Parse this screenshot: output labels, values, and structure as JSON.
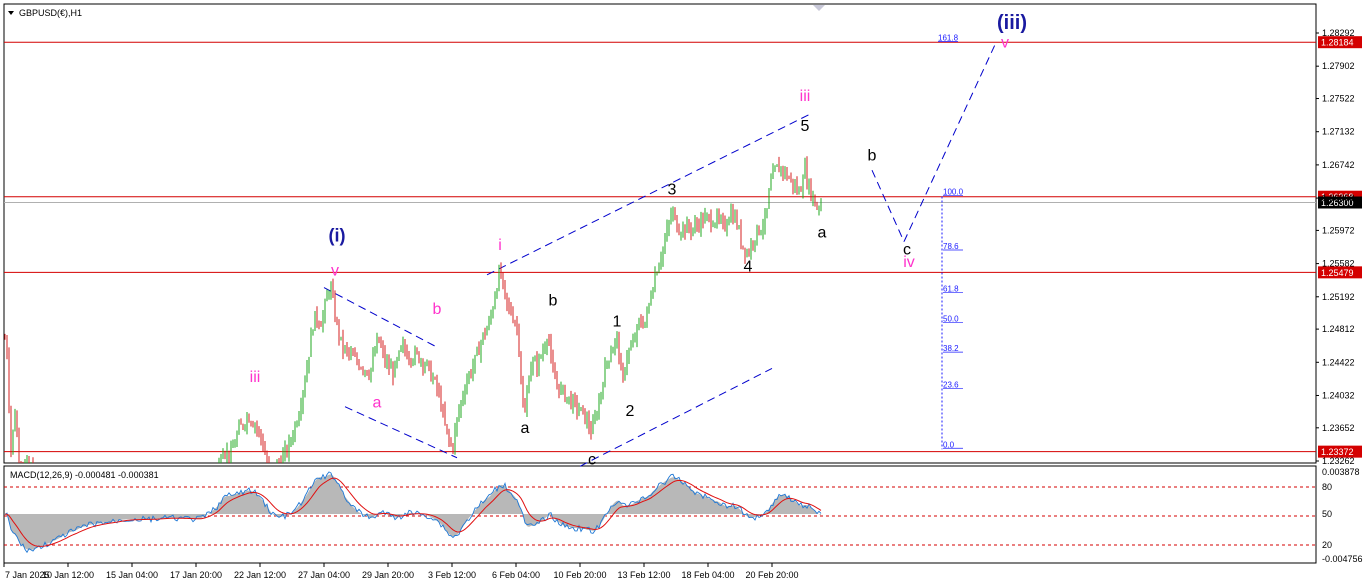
{
  "header": {
    "symbol_title": "GBPUSD(€),H1",
    "macd_title": "MACD(12,26,9) -0.000481 -0.000381"
  },
  "colors": {
    "up_candle": "#22aa22",
    "down_candle": "#d42020",
    "resistance_line": "#d40000",
    "trendline": "#0000cc",
    "fib_line": "#1a1aff",
    "macd_hist": "#b8b8b8",
    "macd_line": "#1e78d6",
    "signal_line": "#e01010",
    "wave_blue": "#1a1aa0",
    "wave_magenta": "#ff33cc",
    "wave_black": "#000000"
  },
  "chart_data": [
    {
      "type": "candlestick",
      "title": "GBPUSD(€),H1",
      "ylim": [
        1.23262,
        1.28292
      ],
      "y_ticks": [
        "1.28292",
        "1.27902",
        "1.27522",
        "1.27132",
        "1.26742",
        "1.26352",
        "1.25972",
        "1.25582",
        "1.25192",
        "1.24812",
        "1.24422",
        "1.24032",
        "1.23652",
        "1.23262"
      ],
      "x_ticks": [
        "7 Jan 2025",
        "10 Jan 12:00",
        "15 Jan 04:00",
        "17 Jan 20:00",
        "22 Jan 12:00",
        "27 Jan 04:00",
        "29 Jan 20:00",
        "3 Feb 12:00",
        "6 Feb 04:00",
        "10 Feb 20:00",
        "13 Feb 12:00",
        "18 Feb 04:00",
        "20 Feb 20:00"
      ],
      "price_anchors": [
        [
          0,
          1.2483
        ],
        [
          2,
          1.249
        ],
        [
          4,
          1.247
        ],
        [
          6,
          1.247
        ],
        [
          8,
          1.244
        ],
        [
          10,
          1.235
        ],
        [
          12,
          1.233
        ],
        [
          14,
          1.239
        ],
        [
          16,
          1.238
        ],
        [
          18,
          1.233
        ],
        [
          48,
          1.23
        ],
        [
          200,
          1.225
        ],
        [
          216,
          1.23
        ],
        [
          222,
          1.2345
        ],
        [
          230,
          1.233
        ],
        [
          238,
          1.236
        ],
        [
          248,
          1.238
        ],
        [
          255,
          1.237
        ],
        [
          262,
          1.235
        ],
        [
          270,
          1.231
        ],
        [
          288,
          1.234
        ],
        [
          298,
          1.238
        ],
        [
          306,
          1.243
        ],
        [
          314,
          1.2495
        ],
        [
          322,
          1.249
        ],
        [
          330,
          1.2535
        ],
        [
          336,
          1.249
        ],
        [
          342,
          1.246
        ],
        [
          350,
          1.245
        ],
        [
          360,
          1.244
        ],
        [
          370,
          1.243
        ],
        [
          378,
          1.247
        ],
        [
          386,
          1.244
        ],
        [
          394,
          1.243
        ],
        [
          402,
          1.246
        ],
        [
          410,
          1.245
        ],
        [
          418,
          1.245
        ],
        [
          426,
          1.244
        ],
        [
          434,
          1.242
        ],
        [
          440,
          1.24
        ],
        [
          446,
          1.236
        ],
        [
          452,
          1.234
        ],
        [
          458,
          1.238
        ],
        [
          466,
          1.242
        ],
        [
          474,
          1.244
        ],
        [
          482,
          1.247
        ],
        [
          490,
          1.249
        ],
        [
          496,
          1.253
        ],
        [
          500,
          1.255
        ],
        [
          506,
          1.251
        ],
        [
          512,
          1.25
        ],
        [
          518,
          1.248
        ],
        [
          524,
          1.237
        ],
        [
          530,
          1.244
        ],
        [
          538,
          1.244
        ],
        [
          544,
          1.246
        ],
        [
          548,
          1.248
        ],
        [
          552,
          1.243
        ],
        [
          560,
          1.241
        ],
        [
          568,
          1.24
        ],
        [
          576,
          1.239
        ],
        [
          584,
          1.238
        ],
        [
          592,
          1.236
        ],
        [
          598,
          1.239
        ],
        [
          606,
          1.244
        ],
        [
          612,
          1.246
        ],
        [
          618,
          1.247
        ],
        [
          622,
          1.241
        ],
        [
          626,
          1.245
        ],
        [
          632,
          1.246
        ],
        [
          640,
          1.249
        ],
        [
          646,
          1.249
        ],
        [
          652,
          1.253
        ],
        [
          656,
          1.255
        ],
        [
          664,
          1.258
        ],
        [
          672,
          1.262
        ],
        [
          678,
          1.26
        ],
        [
          686,
          1.26
        ],
        [
          694,
          1.26
        ],
        [
          702,
          1.261
        ],
        [
          708,
          1.261
        ],
        [
          716,
          1.261
        ],
        [
          724,
          1.26
        ],
        [
          730,
          1.262
        ],
        [
          736,
          1.261
        ],
        [
          742,
          1.258
        ],
        [
          748,
          1.257
        ],
        [
          754,
          1.259
        ],
        [
          760,
          1.26
        ],
        [
          766,
          1.261
        ],
        [
          770,
          1.265
        ],
        [
          776,
          1.267
        ],
        [
          782,
          1.267
        ],
        [
          788,
          1.266
        ],
        [
          794,
          1.265
        ],
        [
          800,
          1.264
        ],
        [
          804,
          1.2675
        ],
        [
          808,
          1.265
        ],
        [
          812,
          1.264
        ],
        [
          816,
          1.2625
        ],
        [
          822,
          1.263
        ]
      ],
      "horizontal_levels": [
        {
          "label": "1.28184",
          "value": 1.28184
        },
        {
          "label": "1.26368",
          "value": 1.26368
        },
        {
          "label": "1.25479",
          "value": 1.25479
        },
        {
          "label": "1.23372",
          "value": 1.23372
        }
      ],
      "current_price": {
        "label": "1.26300",
        "value": 1.263
      },
      "fib_levels": [
        {
          "label": "161.8",
          "value": 1.2818
        },
        {
          "label": "100.0",
          "value": 1.2637
        },
        {
          "label": "78.6",
          "value": 1.2573
        },
        {
          "label": "61.8",
          "value": 1.2523
        },
        {
          "label": "50.0",
          "value": 1.2488
        },
        {
          "label": "38.2",
          "value": 1.2453
        },
        {
          "label": "23.6",
          "value": 1.241
        },
        {
          "label": "0.0",
          "value": 1.234
        }
      ],
      "wave_labels": [
        {
          "text": "(iii)",
          "color": "#1a1aa0",
          "value": 1.284
        },
        {
          "text": "v",
          "color": "#ff33cc",
          "value": 1.2818
        },
        {
          "text": "iii",
          "color": "#ff33cc",
          "value": 1.2755
        },
        {
          "text": "5",
          "color": "#000000",
          "value": 1.272
        },
        {
          "text": "b",
          "color": "#000000",
          "value": 1.2685
        },
        {
          "text": "3",
          "color": "#000000",
          "value": 1.2645
        },
        {
          "text": "(i)",
          "color": "#1a1aa0",
          "value": 1.259
        },
        {
          "text": "a",
          "color": "#000000",
          "value": 1.2595
        },
        {
          "text": "i",
          "color": "#ff33cc",
          "value": 1.258
        },
        {
          "text": "c",
          "color": "#000000",
          "value": 1.2575
        },
        {
          "text": "iv",
          "color": "#ff33cc",
          "value": 1.256
        },
        {
          "text": "v",
          "color": "#ff33cc",
          "value": 1.255
        },
        {
          "text": "4",
          "color": "#000000",
          "value": 1.2555
        },
        {
          "text": "b",
          "color": "#ff33cc",
          "value": 1.2505
        },
        {
          "text": "b",
          "color": "#000000",
          "value": 1.2515
        },
        {
          "text": "1",
          "color": "#000000",
          "value": 1.249
        },
        {
          "text": "iii",
          "color": "#ff33cc",
          "value": 1.2425
        },
        {
          "text": "a",
          "color": "#ff33cc",
          "value": 1.2395
        },
        {
          "text": "2",
          "color": "#000000",
          "value": 1.2385
        },
        {
          "text": "a",
          "color": "#000000",
          "value": 1.2365
        },
        {
          "text": "c",
          "color": "#000000",
          "value": 1.2328
        }
      ]
    },
    {
      "type": "line",
      "title": "MACD(12,26,9) -0.000481 -0.000381",
      "y_ticks": [
        "0.003878",
        "80",
        "50",
        "20",
        "-0.004756"
      ],
      "series": [
        {
          "name": "MACD",
          "value": -0.000481
        },
        {
          "name": "Signal",
          "value": -0.000381
        }
      ]
    }
  ]
}
